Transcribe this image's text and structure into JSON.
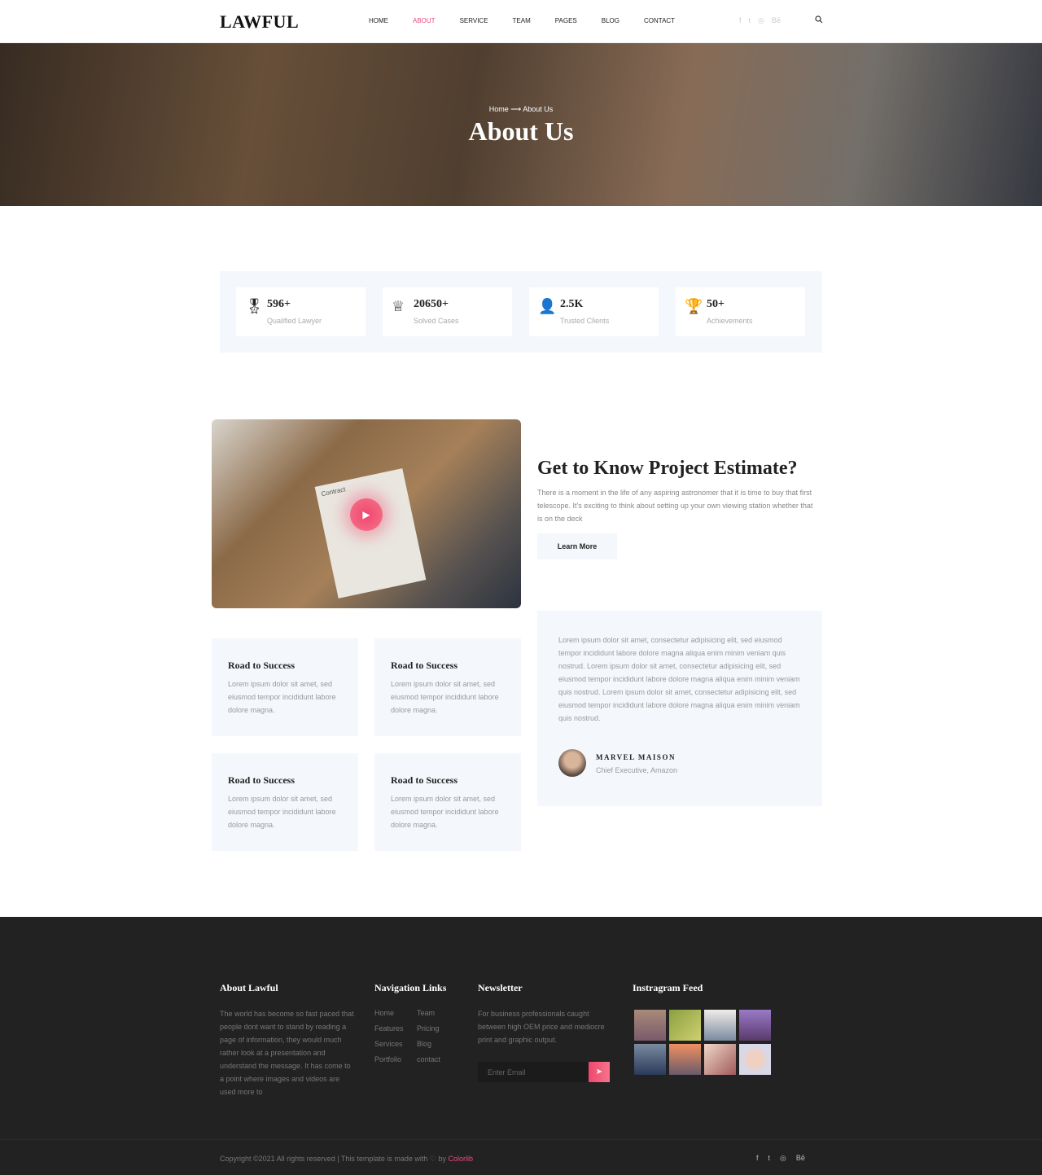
{
  "header": {
    "logo": "LAWFUL",
    "nav": [
      "HOME",
      "ABOUT",
      "SERVICE",
      "TEAM",
      "PAGES",
      "BLOG",
      "CONTACT"
    ],
    "active": "ABOUT",
    "social": [
      "f",
      "t",
      "◎",
      "Bē"
    ]
  },
  "hero": {
    "crumb_home": "Home",
    "crumb_arrow": "⟶",
    "crumb_current": "About Us",
    "title": "About Us"
  },
  "stats": [
    {
      "icon": "award-icon",
      "glyph": "🎖",
      "value": "596+",
      "label": "Qualified Lawyer"
    },
    {
      "icon": "crown-icon",
      "glyph": "♕",
      "value": "20650+",
      "label": "Solved Cases"
    },
    {
      "icon": "user-icon",
      "glyph": "👤",
      "value": "2.5K",
      "label": "Trusted Clients"
    },
    {
      "icon": "trophy-icon",
      "glyph": "🏆",
      "value": "50+",
      "label": "Achievements"
    }
  ],
  "about": {
    "video_label": "Contract",
    "title": "Get to Know Project Estimate?",
    "text": "There is a moment in the life of any aspiring astronomer that it is time to buy that first telescope. It's exciting to think about setting up your own viewing station whether that is on the deck",
    "button": "Learn More"
  },
  "cards": [
    {
      "title": "Road to Success",
      "text": "Lorem ipsum dolor sit amet, sed eiusmod tempor incididunt labore dolore magna."
    },
    {
      "title": "Road to Success",
      "text": "Lorem ipsum dolor sit amet, sed eiusmod tempor incididunt labore dolore magna."
    },
    {
      "title": "Road to Success",
      "text": "Lorem ipsum dolor sit amet, sed eiusmod tempor incididunt labore dolore magna."
    },
    {
      "title": "Road to Success",
      "text": "Lorem ipsum dolor sit amet, sed eiusmod tempor incididunt labore dolore magna."
    }
  ],
  "testimonial": {
    "text": "Lorem ipsum dolor sit amet, consectetur adipisicing elit, sed eiusmod tempor incididunt labore dolore magna aliqua enim minim veniam quis nostrud. Lorem ipsum dolor sit amet, consectetur adipisicing elit, sed eiusmod tempor incididunt labore dolore magna aliqua enim minim veniam quis nostrud. Lorem ipsum dolor sit amet, consectetur adipisicing elit, sed eiusmod tempor incididunt labore dolore magna aliqua enim minim veniam quis nostrud.",
    "name": "MARVEL MAISON",
    "role": "Chief Executive, Amazon"
  },
  "footer": {
    "about_title": "About Lawful",
    "about_text": "The world has become so fast paced that people dont want to stand by reading a page of information, they would much rather look at a presentation and understand the message. It has come to a point where images and videos are used more to",
    "nav_title": "Navigation Links",
    "nav": [
      "Home",
      "Team",
      "Features",
      "Pricing",
      "Services",
      "Blog",
      "Portfolio",
      "contact"
    ],
    "news_title": "Newsletter",
    "news_text": "For business professionals caught between high OEM price and mediocre print and graphic output.",
    "email_placeholder": "Enter Email",
    "insta_title": "Instragram Feed",
    "copyright": "Copyright ©2021 All rights reserved | This template is made with ♡ by ",
    "credit": "Colorlib",
    "social": [
      "f",
      "t",
      "◎",
      "Bē"
    ]
  },
  "colors": {
    "accent": "#e94b7c",
    "light_bg": "#f4f8fd",
    "footer_bg": "#222222"
  }
}
